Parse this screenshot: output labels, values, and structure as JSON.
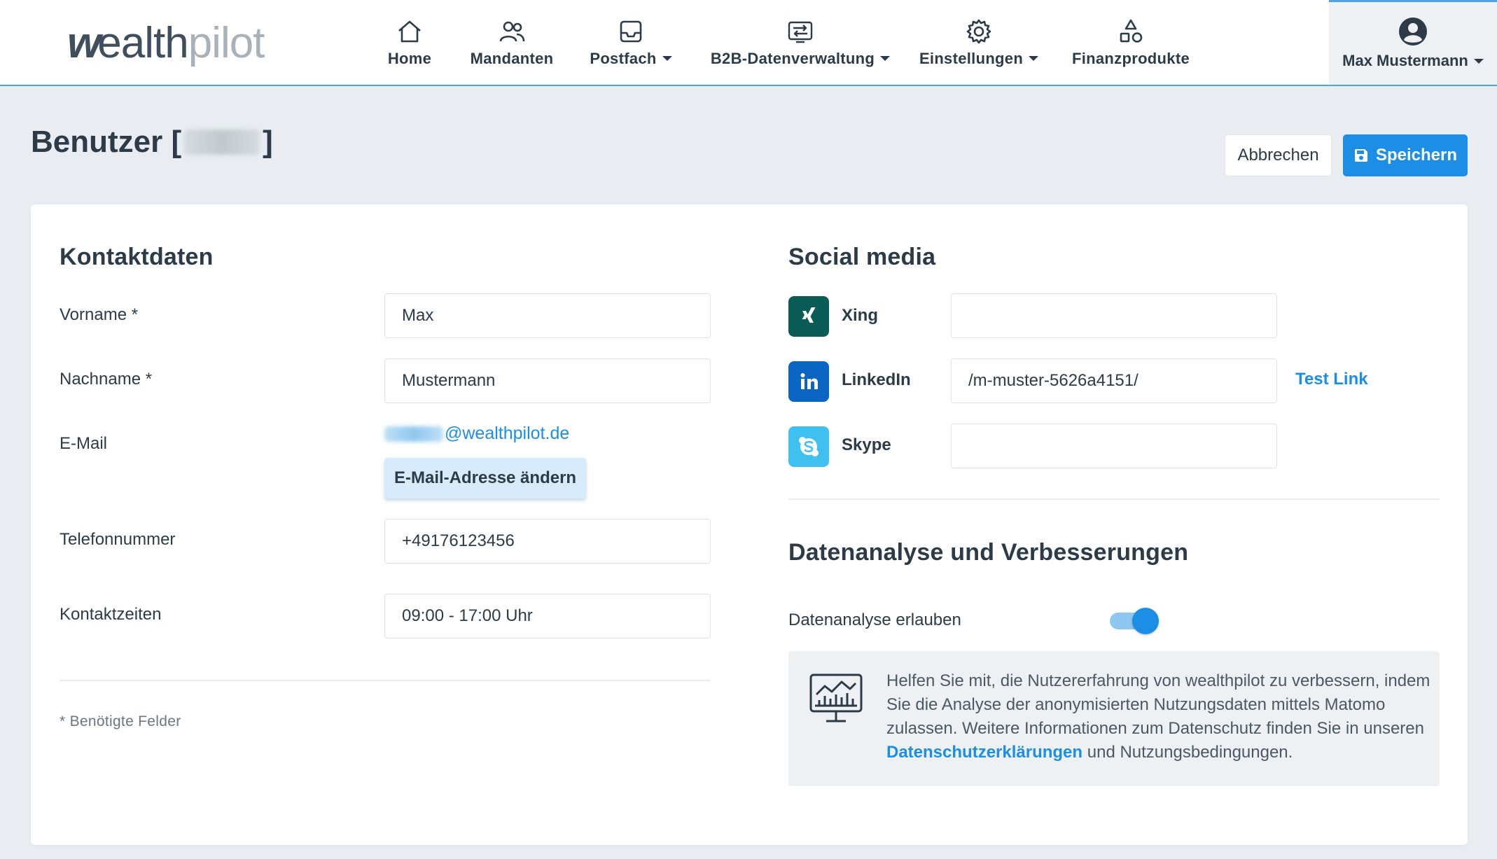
{
  "brand": {
    "logo_w": "w",
    "logo_dark": "ealth",
    "logo_light": "pilot"
  },
  "nav": {
    "items": [
      {
        "label": "Home",
        "icon": "home-icon",
        "dropdown": false
      },
      {
        "label": "Mandanten",
        "icon": "users-icon",
        "dropdown": false
      },
      {
        "label": "Postfach",
        "icon": "inbox-icon",
        "dropdown": true
      },
      {
        "label": "B2B-Datenverwaltung",
        "icon": "data-transfer-icon",
        "dropdown": true
      },
      {
        "label": "Einstellungen",
        "icon": "gear-icon",
        "dropdown": true
      },
      {
        "label": "Finanzprodukte",
        "icon": "shapes-icon",
        "dropdown": false
      }
    ],
    "user": {
      "name": "Max Mustermann",
      "icon": "user-circle-icon"
    }
  },
  "page": {
    "title_prefix": "Benutzer [",
    "title_suffix": "]",
    "cancel_label": "Abbrechen",
    "save_label": "Speichern"
  },
  "contact": {
    "section_title": "Kontaktdaten",
    "firstname": {
      "label": "Vorname *",
      "value": "Max"
    },
    "lastname": {
      "label": "Nachname *",
      "value": "Mustermann"
    },
    "email": {
      "label": "E-Mail",
      "domain": "@wealthpilot.de",
      "change_label": "E-Mail-Adresse ändern"
    },
    "phone": {
      "label": "Telefonnummer",
      "value": "+49176123456"
    },
    "times": {
      "label": "Kontaktzeiten",
      "value": "09:00 - 17:00 Uhr"
    },
    "required_hint": "* Benötigte Felder"
  },
  "social": {
    "section_title": "Social media",
    "xing": {
      "label": "Xing",
      "value": "",
      "color": "#0a5c57"
    },
    "linkedin": {
      "label": "LinkedIn",
      "value": "/m-muster-5626a4151/",
      "test_link": "Test Link",
      "color": "#0a66c2"
    },
    "skype": {
      "label": "Skype",
      "value": "",
      "color": "#40c0f0"
    }
  },
  "analytics": {
    "section_title": "Datenanalyse und Verbesserungen",
    "toggle_label": "Datenanalyse erlauben",
    "toggle_on": true,
    "info_text_1": "Helfen Sie mit, die Nutzererfahrung von wealthpilot zu verbessern, indem Sie die Analyse der anonymisierten Nutzungsdaten mittels Matomo zulassen. Weitere Informationen zum Datenschutz finden Sie in unseren ",
    "info_link": "Datenschutzerklärungen",
    "info_text_2": " und Nutzungsbedingungen."
  },
  "colors": {
    "accent": "#1c8ee6",
    "text": "#2d3b48",
    "background": "#e9edf1"
  }
}
